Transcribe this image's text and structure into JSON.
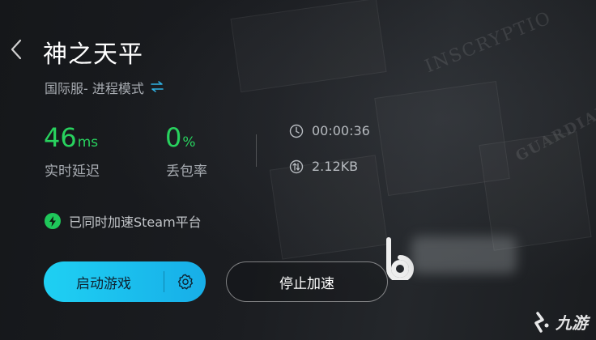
{
  "header": {
    "title": "神之天平",
    "mode": "国际服- 进程模式"
  },
  "stats": {
    "latency_value": "46",
    "latency_unit": "ms",
    "latency_label": "实时延迟",
    "loss_value": "0",
    "loss_unit": "%",
    "loss_label": "丢包率",
    "duration": "00:00:36",
    "traffic": "2.12KB"
  },
  "accel_note": "已同时加速Steam平台",
  "buttons": {
    "start_label": "启动游戏",
    "stop_label": "停止加速"
  },
  "watermark": {
    "site_logo_text": "九游"
  },
  "colors": {
    "accent_green": "#28d25e",
    "accent_blue": "#1fd0f3",
    "background": "#141618"
  },
  "icons": {
    "back": "chevron-left-icon",
    "swap": "swap-icon",
    "clock": "clock-icon",
    "traffic": "traffic-icon",
    "bolt": "bolt-icon",
    "gear": "gear-icon"
  }
}
